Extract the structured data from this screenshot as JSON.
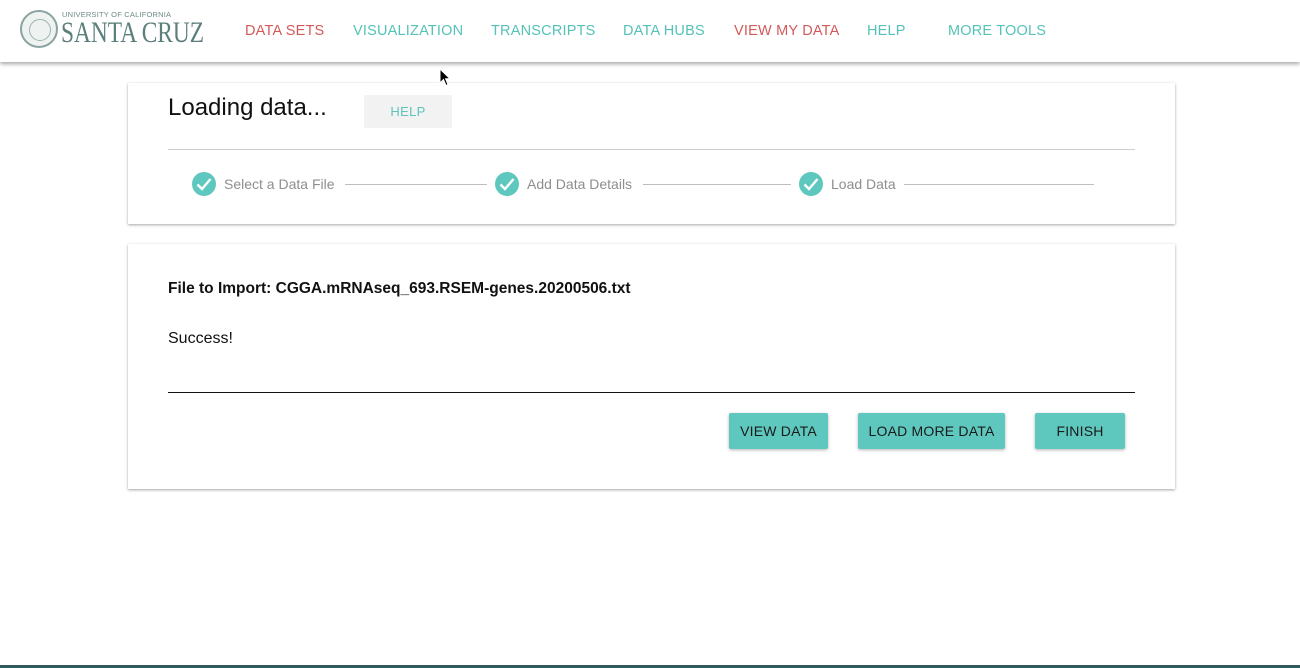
{
  "header": {
    "logo": {
      "university": "UNIVERSITY OF CALIFORNIA",
      "campus": "SANTA CRUZ"
    },
    "nav": [
      {
        "label": "DATA SETS",
        "color": "#d25a5a"
      },
      {
        "label": "VISUALIZATION",
        "color": "#55c2b8"
      },
      {
        "label": "TRANSCRIPTS",
        "color": "#55c2b8"
      },
      {
        "label": "DATA HUBS",
        "color": "#55c2b8"
      },
      {
        "label": "VIEW MY DATA",
        "color": "#d25a5a"
      },
      {
        "label": "HELP",
        "color": "#55c2b8"
      },
      {
        "label": "MORE TOOLS",
        "color": "#55c2b8"
      }
    ]
  },
  "loading": {
    "title": "Loading data...",
    "help_label": "HELP",
    "steps": [
      {
        "label": "Select a Data File",
        "done": true
      },
      {
        "label": "Add Data Details",
        "done": true
      },
      {
        "label": "Load Data",
        "done": true
      }
    ]
  },
  "result": {
    "file_line": "File to Import: CGGA.mRNAseq_693.RSEM-genes.20200506.txt",
    "status": "Success!",
    "buttons": {
      "view_data": "VIEW DATA",
      "load_more": "LOAD MORE DATA",
      "finish": "FINISH"
    }
  },
  "colors": {
    "accent": "#5ec8bf",
    "nav_red": "#d25a5a",
    "nav_teal": "#55c2b8"
  }
}
